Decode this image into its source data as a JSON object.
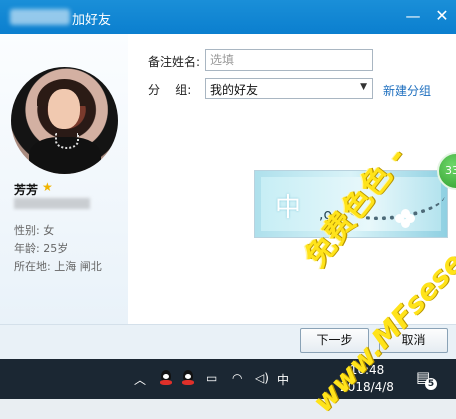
{
  "window": {
    "title": "加好友",
    "minimize_glyph": "—",
    "close_glyph": "✕"
  },
  "profile": {
    "nickname": "芳芳",
    "star_icon": "★",
    "gender": "性别: 女",
    "age": "年龄: 25岁",
    "location": "所在地: 上海  闸北"
  },
  "form": {
    "remark_label": "备注姓名:",
    "remark_placeholder": "选填",
    "remark_value": "",
    "group_label": "分    组:",
    "group_selected": "我的好友",
    "new_group_link": "新建分组"
  },
  "banner": {
    "char": "中",
    "sub": ",o"
  },
  "badge": {
    "text": "33"
  },
  "buttons": {
    "next": "下一步",
    "cancel": "取消"
  },
  "watermark": {
    "cn": "免费色色 -",
    "url": "www.MFsese.com"
  },
  "taskbar": {
    "chevron": "︿",
    "ime": "中",
    "time": "16:48",
    "date": "2018/4/8",
    "notification_count": "5"
  },
  "colors": {
    "titlebar": "#0b7fcf",
    "link": "#1e6fbf",
    "taskbar": "#1b2733",
    "watermark": "#ffe31a",
    "badge_green": "#2d9a2b"
  }
}
